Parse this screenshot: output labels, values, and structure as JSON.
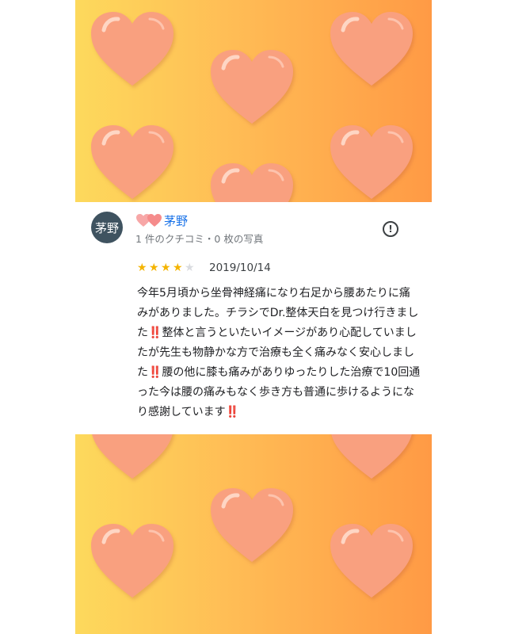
{
  "background": {
    "gradient_colors": [
      "#fdd95c",
      "#ffbc55",
      "#ff9a45"
    ],
    "decoration": "heart-icon",
    "heart_color": "#f9a07f"
  },
  "review": {
    "avatar_text": "茅野",
    "avatar_color": "#3f5360",
    "name_prefix_icon": "two-hearts-icon",
    "reviewer_name": "茅野",
    "meta": "1 件のクチコミ・0 枚の写真",
    "report_icon": "report-icon",
    "rating": 4,
    "rating_max": 5,
    "date": "2019/10/14",
    "text_parts": [
      "今年5月頃から坐骨神経痛になり右足から腰あたりに痛みがありました。チラシでDr.整体天白を見つけ行きました",
      "‼️",
      "整体と言うといたいイメージがあり心配していましたが先生も物静かな方で治療も全く痛みなく安心しました",
      "‼️",
      "腰の他に膝も痛みがありゆったりした治療で10回通った今は腰の痛みもなく歩き方も普通に歩けるようになり感謝しています",
      "‼️"
    ]
  }
}
